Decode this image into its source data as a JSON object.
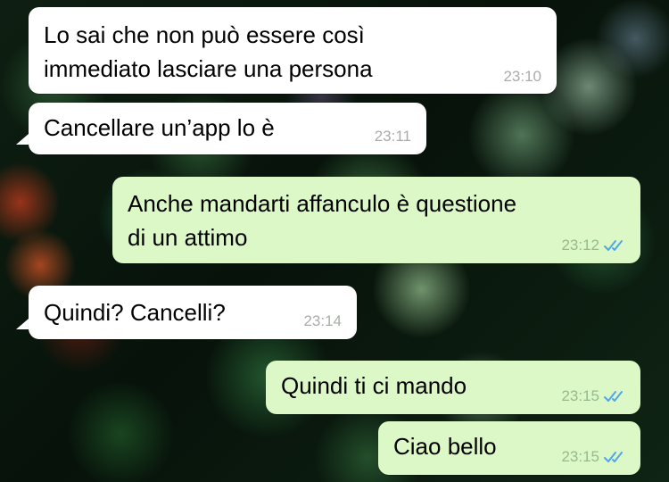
{
  "chat": {
    "messages": [
      {
        "direction": "in",
        "lines": [
          "Lo sai che non può essere così",
          "immediato lasciare una persona"
        ],
        "time": "23:10"
      },
      {
        "direction": "in",
        "lines": [
          "Cancellare un’app lo è"
        ],
        "time": "23:11"
      },
      {
        "direction": "out",
        "lines": [
          "Anche mandarti affanculo è questione",
          "di un attimo"
        ],
        "time": "23:12",
        "status": "read"
      },
      {
        "direction": "in",
        "lines": [
          "Quindi? Cancelli?"
        ],
        "time": "23:14"
      },
      {
        "direction": "out",
        "lines": [
          "Quindi ti ci mando"
        ],
        "time": "23:15",
        "status": "read"
      },
      {
        "direction": "out",
        "lines": [
          "Ciao bello"
        ],
        "time": "23:15",
        "status": "read"
      }
    ]
  },
  "colors": {
    "incoming_bubble": "#ffffff",
    "outgoing_bubble": "#dcf8c6",
    "read_ticks": "#4fa7e8"
  },
  "icons": {
    "read_receipt": "double-check-icon"
  }
}
